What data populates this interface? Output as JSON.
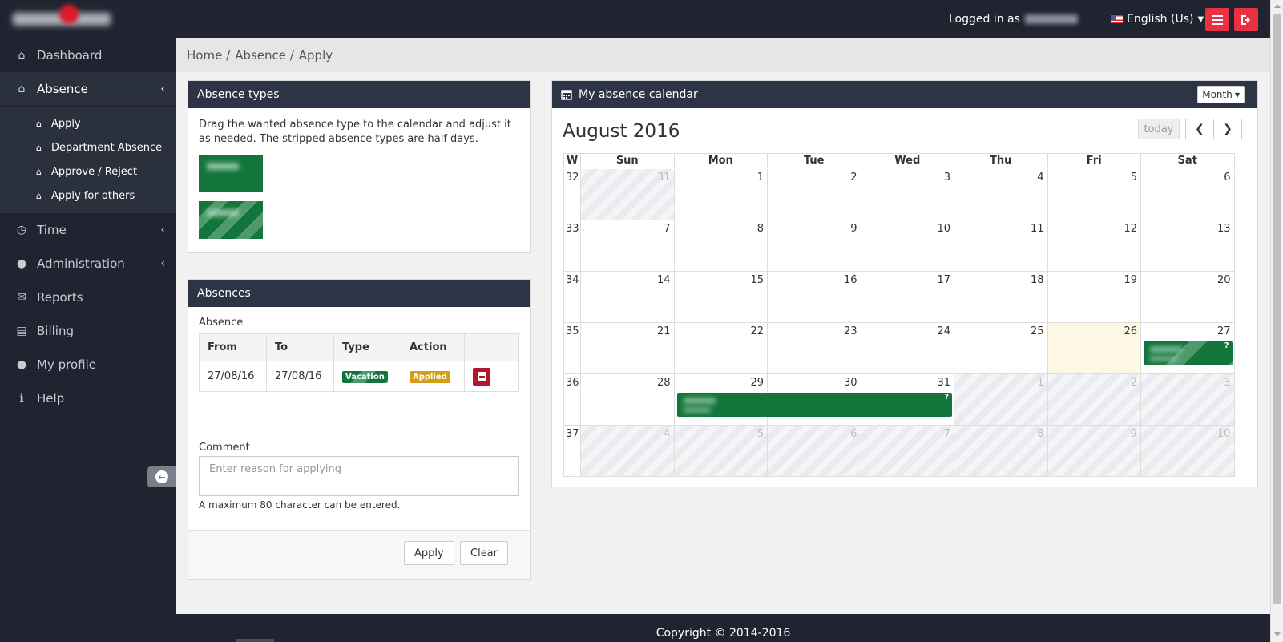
{
  "header": {
    "logged_in_label": "Logged in as",
    "language": "English (Us)"
  },
  "sidebar": {
    "items": [
      {
        "label": "Dashboard",
        "icon": "home-icon"
      },
      {
        "label": "Absence",
        "icon": "home-icon"
      },
      {
        "label": "Time",
        "icon": "clock-icon"
      },
      {
        "label": "Administration",
        "icon": "user-icon"
      },
      {
        "label": "Reports",
        "icon": "envelope-icon"
      },
      {
        "label": "Billing",
        "icon": "credit-card-icon"
      },
      {
        "label": "My profile",
        "icon": "user-icon"
      },
      {
        "label": "Help",
        "icon": "info-icon"
      }
    ],
    "absence_subitems": [
      "Apply",
      "Department Absence",
      "Approve / Reject",
      "Apply for others"
    ]
  },
  "breadcrumb": [
    "Home /",
    "Absence /",
    "Apply"
  ],
  "absence_types": {
    "title": "Absence types",
    "description": "Drag the wanted absence type to the calendar and adjust it as needed. The stripped absence types are half days."
  },
  "absences": {
    "title": "Absences",
    "label": "Absence",
    "columns": [
      "From",
      "To",
      "Type",
      "Action",
      ""
    ],
    "rows": [
      {
        "from": "27/08/16",
        "to": "27/08/16",
        "type": "Vacation",
        "action": "Applied"
      }
    ],
    "comment_label": "Comment",
    "comment_placeholder": "Enter reason for applying",
    "hint": "A maximum 80 character can be entered.",
    "apply_button": "Apply",
    "clear_button": "Clear"
  },
  "calendar": {
    "title": "My absence calendar",
    "view_button": "Month",
    "month_title": "August 2016",
    "today_button": "today",
    "headers": [
      "W",
      "Sun",
      "Mon",
      "Tue",
      "Wed",
      "Thu",
      "Fri",
      "Sat"
    ],
    "weeks": [
      {
        "week": "32",
        "days": [
          "31",
          "1",
          "2",
          "3",
          "4",
          "5",
          "6"
        ]
      },
      {
        "week": "33",
        "days": [
          "7",
          "8",
          "9",
          "10",
          "11",
          "12",
          "13"
        ]
      },
      {
        "week": "34",
        "days": [
          "14",
          "15",
          "16",
          "17",
          "18",
          "19",
          "20"
        ]
      },
      {
        "week": "35",
        "days": [
          "21",
          "22",
          "23",
          "24",
          "25",
          "26",
          "27"
        ]
      },
      {
        "week": "36",
        "days": [
          "28",
          "29",
          "30",
          "31",
          "1",
          "2",
          "3"
        ]
      },
      {
        "week": "37",
        "days": [
          "4",
          "5",
          "6",
          "7",
          "8",
          "9",
          "10"
        ]
      }
    ],
    "event_marker": "?"
  },
  "footer": "Copyright © 2014-2016",
  "colors": {
    "dark": "#1f2430",
    "accent_red": "#ea3043",
    "vacation_green": "#13753b",
    "applied_orange": "#d39e16"
  }
}
